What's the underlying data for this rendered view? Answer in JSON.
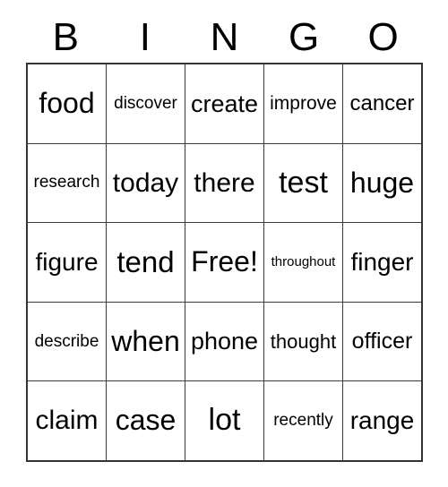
{
  "card": {
    "title": "BINGO",
    "header_letters": [
      "B",
      "I",
      "N",
      "G",
      "O"
    ],
    "free_space_label": "Free!",
    "free_space_position": {
      "row": 2,
      "col": 2
    },
    "grid_size": {
      "rows": 5,
      "columns": 5
    },
    "colors": {
      "background": "#ffffff",
      "text": "#000000",
      "grid_line": "#3a3a3a",
      "grid_border": "#333333"
    },
    "rows": [
      [
        {
          "text": "food",
          "font_size": 32,
          "is_free": false
        },
        {
          "text": "discover",
          "font_size": 19,
          "is_free": false
        },
        {
          "text": "create",
          "font_size": 27,
          "is_free": false
        },
        {
          "text": "improve",
          "font_size": 21,
          "is_free": false
        },
        {
          "text": "cancer",
          "font_size": 24,
          "is_free": false
        }
      ],
      [
        {
          "text": "research",
          "font_size": 19,
          "is_free": false
        },
        {
          "text": "today",
          "font_size": 30,
          "is_free": false
        },
        {
          "text": "there",
          "font_size": 30,
          "is_free": false
        },
        {
          "text": "test",
          "font_size": 34,
          "is_free": false
        },
        {
          "text": "huge",
          "font_size": 32,
          "is_free": false
        }
      ],
      [
        {
          "text": "figure",
          "font_size": 28,
          "is_free": false
        },
        {
          "text": "tend",
          "font_size": 33,
          "is_free": false
        },
        {
          "text": "Free!",
          "font_size": 32,
          "is_free": true
        },
        {
          "text": "throughout",
          "font_size": 15,
          "is_free": false
        },
        {
          "text": "finger",
          "font_size": 28,
          "is_free": false
        }
      ],
      [
        {
          "text": "describe",
          "font_size": 19,
          "is_free": false
        },
        {
          "text": "when",
          "font_size": 32,
          "is_free": false
        },
        {
          "text": "phone",
          "font_size": 27,
          "is_free": false
        },
        {
          "text": "thought",
          "font_size": 22,
          "is_free": false
        },
        {
          "text": "officer",
          "font_size": 25,
          "is_free": false
        }
      ],
      [
        {
          "text": "claim",
          "font_size": 30,
          "is_free": false
        },
        {
          "text": "case",
          "font_size": 32,
          "is_free": false
        },
        {
          "text": "lot",
          "font_size": 34,
          "is_free": false
        },
        {
          "text": "recently",
          "font_size": 19,
          "is_free": false
        },
        {
          "text": "range",
          "font_size": 28,
          "is_free": false
        }
      ]
    ]
  }
}
